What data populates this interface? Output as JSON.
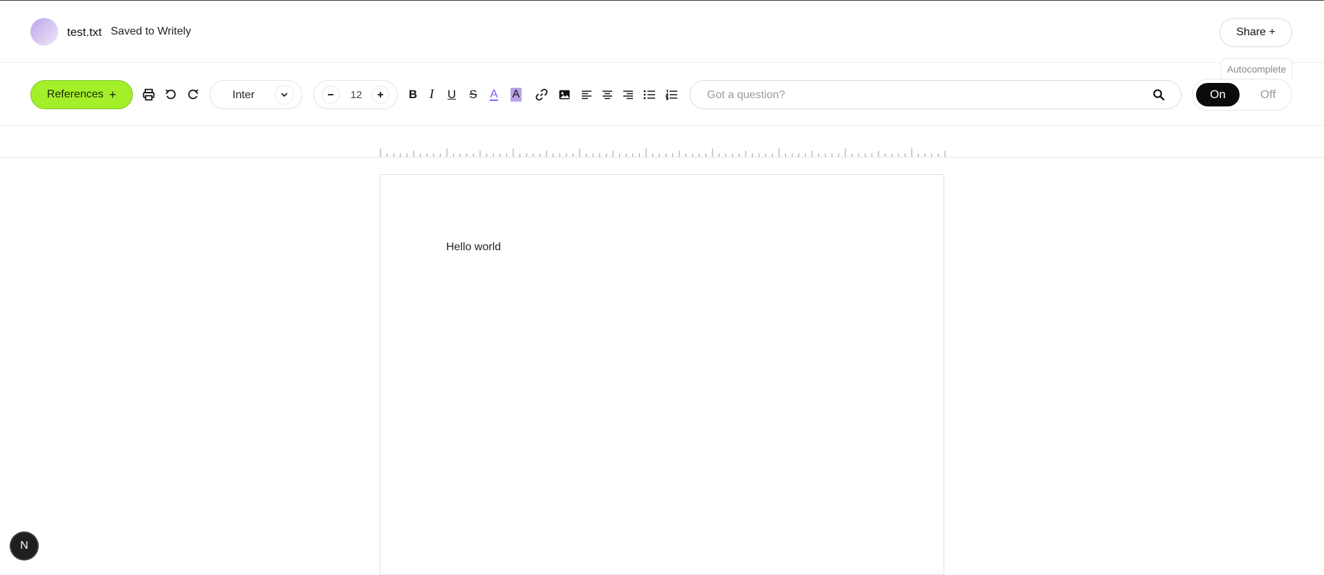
{
  "header": {
    "filename": "test.txt",
    "save_status": "Saved to Writely",
    "share_label": "Share +"
  },
  "toolbar": {
    "references_label": "References",
    "references_plus": "+",
    "font_name": "Inter",
    "font_size": "12",
    "search_placeholder": "Got a question?",
    "autocomplete_label": "Autocomplete",
    "autocomplete_on": "On",
    "autocomplete_off": "Off",
    "icons": [
      "print-icon",
      "undo-icon",
      "redo-icon",
      "chevron-down-icon",
      "minus-icon",
      "plus-icon",
      "bold-icon",
      "italic-icon",
      "underline-icon",
      "strikethrough-icon",
      "text-color-icon",
      "highlight-icon",
      "link-icon",
      "image-icon",
      "align-left-icon",
      "align-center-icon",
      "align-right-icon",
      "bullet-list-icon",
      "numbered-list-icon",
      "search-icon"
    ],
    "accent_color": "#a3ef2a",
    "highlight_color": "#b9a2e6",
    "text_color_underline": "#8b5cf6"
  },
  "document": {
    "body_text": "Hello world"
  },
  "badge": {
    "label": "N"
  }
}
